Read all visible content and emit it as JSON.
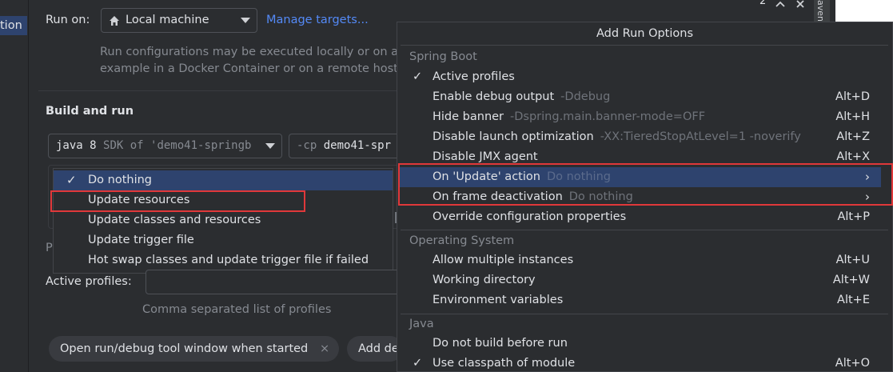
{
  "left_tab": {
    "label": "tion"
  },
  "run_on": {
    "label": "Run on:",
    "target": "Local machine",
    "manage_link": "Manage targets...",
    "description_line1": "Run configurations may be executed locally or on a",
    "description_line2": "example in a Docker Container or on a remote host"
  },
  "build_and_run": {
    "heading": "Build and run",
    "sdk_value": "java 8",
    "sdk_hint": "SDK of 'demo41-springb",
    "cp_prefix": "-cp",
    "cp_value": "demo41-spr"
  },
  "update_popup": {
    "items": [
      {
        "label": "Do nothing",
        "checked": true
      },
      {
        "label": "Update resources"
      },
      {
        "label": "Update classes and resources"
      },
      {
        "label": "Update trigger file"
      },
      {
        "label": "Hot swap classes and update trigger file if failed"
      }
    ]
  },
  "profiles": {
    "partial_label": "P",
    "label": "Active profiles:",
    "hint": "Comma separated list of profiles"
  },
  "chips": {
    "open_tool_window": "Open run/debug tool window when started",
    "close_symbol": "×",
    "add_partial": "Add de"
  },
  "window_bits": {
    "num": "2",
    "side_text": "aven"
  },
  "menu": {
    "title": "Add Run Options",
    "groups": {
      "spring_boot": "Spring Boot",
      "operating_system": "Operating System",
      "java": "Java"
    },
    "spring_boot_rows": [
      {
        "label": "Active profiles",
        "checked": true,
        "hint": "",
        "shortcut": ""
      },
      {
        "label": "Enable debug output",
        "hint": "-Ddebug",
        "shortcut": "Alt+D"
      },
      {
        "label": "Hide banner",
        "hint": "-Dspring.main.banner-mode=OFF",
        "shortcut": "Alt+H"
      },
      {
        "label": "Disable launch optimization",
        "hint": "-XX:TieredStopAtLevel=1 -noverify",
        "shortcut": "Alt+Z"
      },
      {
        "label": "Disable JMX agent",
        "hint": "",
        "shortcut": "Alt+X"
      },
      {
        "label": "On 'Update' action",
        "hint": "Do nothing",
        "shortcut": "",
        "submenu": "›"
      },
      {
        "label": "On frame deactivation",
        "hint": "Do nothing",
        "shortcut": "",
        "submenu": "›"
      },
      {
        "label": "Override configuration properties",
        "hint": "",
        "shortcut": "Alt+P"
      }
    ],
    "os_rows": [
      {
        "label": "Allow multiple instances",
        "shortcut": "Alt+U"
      },
      {
        "label": "Working directory",
        "shortcut": "Alt+W"
      },
      {
        "label": "Environment variables",
        "shortcut": "Alt+E"
      }
    ],
    "java_rows": [
      {
        "label": "Do not build before run",
        "shortcut": ""
      },
      {
        "label": "Use classpath of module",
        "checked": true,
        "shortcut": "Alt+O"
      }
    ]
  },
  "colors": {
    "background": "#2b2d30",
    "selection": "#2e436e",
    "highlight_box": "#e0383a",
    "link": "#548af7"
  },
  "icons": [
    "home-icon",
    "chevron-down-icon",
    "checkmark-icon",
    "chevron-right-icon",
    "close-icon"
  ]
}
